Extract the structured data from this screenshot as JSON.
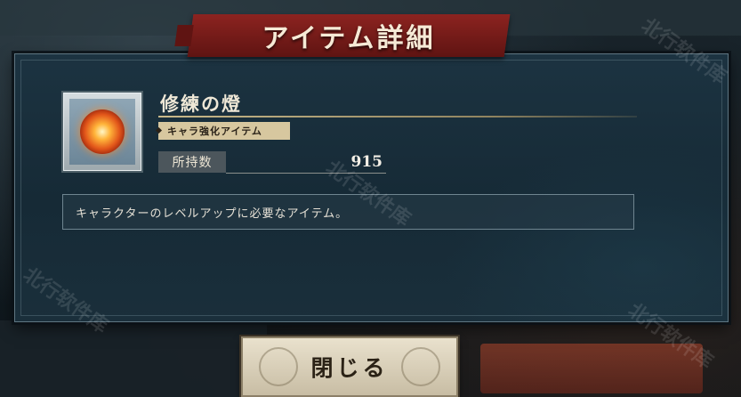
{
  "dialog": {
    "title": "アイテム詳細",
    "item": {
      "name": "修練の燈",
      "category": "キャラ強化アイテム",
      "owned_label": "所持数",
      "owned_count": "915",
      "description": "キャラクターのレベルアップに必要なアイテム。",
      "icon": "flame-orb-icon"
    },
    "close_label": "閉じる"
  },
  "watermark": "北行软件库",
  "colors": {
    "title_banner": "#8c2320",
    "panel_bg": "#1c3341",
    "tag_bg": "#d7c79f",
    "close_button_bg": "#e9e1cd"
  }
}
